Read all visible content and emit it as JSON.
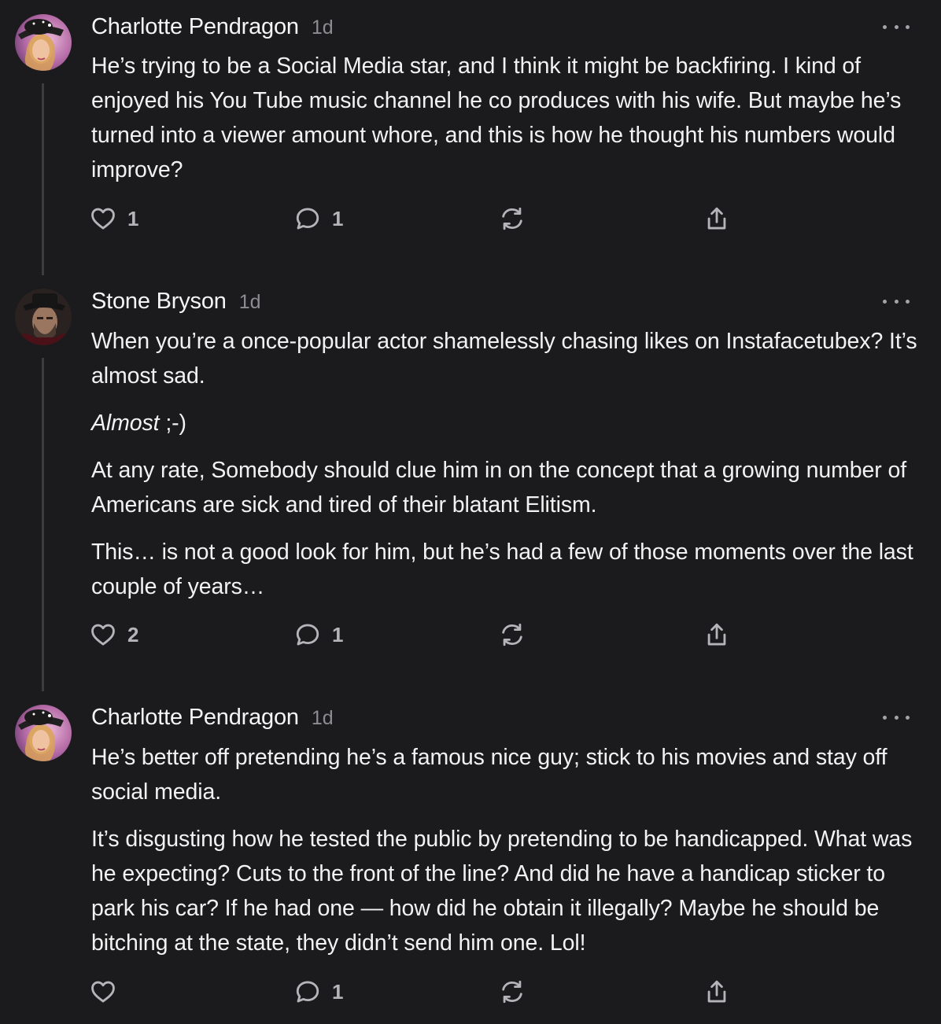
{
  "comments": [
    {
      "author": "Charlotte Pendragon",
      "time": "1d",
      "avatar_icon": "avatar-woman-hat",
      "paragraphs": [
        "He’s trying to be a Social Media star, and I think it might be backfiring. I kind of enjoyed his You Tube music channel he co produces with his wife. But maybe he’s turned into a viewer amount whore, and this is how he thought his numbers would improve?"
      ],
      "likes": "1",
      "replies": "1"
    },
    {
      "author": "Stone Bryson",
      "time": "1d",
      "avatar_icon": "avatar-man-hat",
      "paragraphs": [
        "When you’re a once-popular actor shamelessly chasing likes on Instafacetubex? It’s almost sad.",
        "At any rate, Somebody should clue him in on the concept that a growing number of Americans are sick and tired of their blatant Elitism.",
        "This… is not a good look for him, but he’s had a few of those moments over the last couple of years…"
      ],
      "italic_line": {
        "emphasis": "Almost",
        "rest": " ;-)"
      },
      "likes": "2",
      "replies": "1"
    },
    {
      "author": "Charlotte Pendragon",
      "time": "1d",
      "avatar_icon": "avatar-woman-hat",
      "paragraphs": [
        "He’s better off pretending he’s a famous nice guy; stick to his movies and stay off social media.",
        "It’s disgusting how he tested the public by pretending to be handicapped. What was he expecting? Cuts to the front of the line? And did he have a handicap sticker to park his car? If he had one — how did he obtain it illegally? Maybe he should be bitching at the state, they didn’t send him one. Lol!"
      ],
      "likes": "",
      "replies": "1"
    }
  ],
  "colors": {
    "background": "#1b1b1d",
    "text": "#f2f2f2",
    "muted": "#8d8d91",
    "icon": "#b5b5b9",
    "thread_line": "#3c3c3f"
  }
}
